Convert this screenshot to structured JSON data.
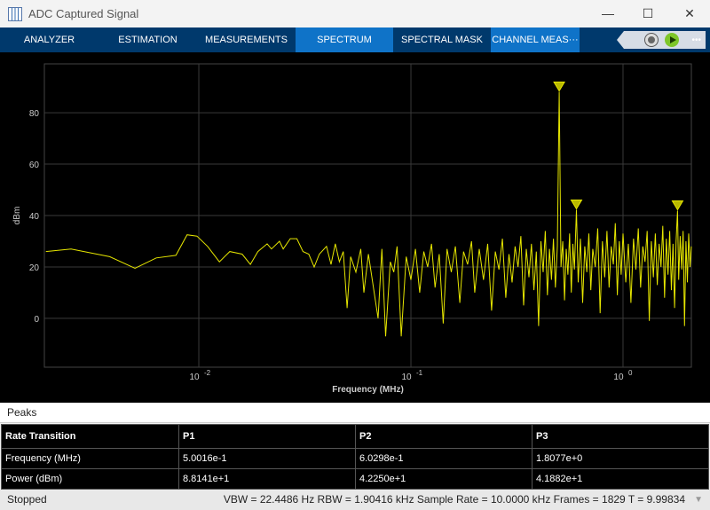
{
  "window": {
    "title": "ADC Captured Signal",
    "minimize": "—",
    "maximize": "☐",
    "close": "✕"
  },
  "tabs": [
    {
      "label": "ANALYZER"
    },
    {
      "label": "ESTIMATION"
    },
    {
      "label": "MEASUREMENTS"
    },
    {
      "label": "SPECTRUM",
      "active": true
    },
    {
      "label": "SPECTRAL MASK"
    },
    {
      "label": "CHANNEL MEAS···"
    }
  ],
  "toolbar": {
    "more": "•••",
    "icons": [
      "settings-gear-icon",
      "run-play-icon",
      "more-icon"
    ]
  },
  "colors": {
    "trace": "#e6e600",
    "marker": "#e6e600",
    "tab_bar": "#00396c",
    "active_tab": "#0f73c8"
  },
  "chart_data": {
    "type": "line",
    "xlabel": "Frequency (MHz)",
    "ylabel": "dBm",
    "xscale": "log",
    "xlim": [
      0.00187,
      2.1
    ],
    "ylim": [
      -19,
      99
    ],
    "xticks": [
      {
        "v": 0.01,
        "base": "10",
        "exp": "-2"
      },
      {
        "v": 0.1,
        "base": "10",
        "exp": "-1"
      },
      {
        "v": 1,
        "base": "10",
        "exp": "0"
      }
    ],
    "yticks": [
      0,
      20,
      40,
      60,
      80
    ],
    "grid": true,
    "trace": [
      [
        0.0019,
        26
      ],
      [
        0.0025,
        27
      ],
      [
        0.0038,
        24
      ],
      [
        0.005,
        19.5
      ],
      [
        0.0063,
        23.5
      ],
      [
        0.0078,
        24.5
      ],
      [
        0.0088,
        32.5
      ],
      [
        0.0098,
        32
      ],
      [
        0.011,
        28
      ],
      [
        0.0125,
        22
      ],
      [
        0.014,
        26
      ],
      [
        0.016,
        25
      ],
      [
        0.0175,
        21
      ],
      [
        0.019,
        26
      ],
      [
        0.021,
        29
      ],
      [
        0.022,
        27
      ],
      [
        0.024,
        30
      ],
      [
        0.025,
        27
      ],
      [
        0.027,
        31
      ],
      [
        0.029,
        31
      ],
      [
        0.031,
        26
      ],
      [
        0.033,
        25
      ],
      [
        0.035,
        20
      ],
      [
        0.037,
        25
      ],
      [
        0.04,
        28
      ],
      [
        0.042,
        21
      ],
      [
        0.044,
        29
      ],
      [
        0.046,
        22
      ],
      [
        0.048,
        26
      ],
      [
        0.05,
        4
      ],
      [
        0.052,
        24
      ],
      [
        0.055,
        18
      ],
      [
        0.058,
        27
      ],
      [
        0.06,
        10
      ],
      [
        0.063,
        25
      ],
      [
        0.066,
        14
      ],
      [
        0.07,
        0
      ],
      [
        0.073,
        27
      ],
      [
        0.076,
        -7
      ],
      [
        0.08,
        22
      ],
      [
        0.083,
        18
      ],
      [
        0.086,
        28
      ],
      [
        0.09,
        -7
      ],
      [
        0.095,
        24
      ],
      [
        0.1,
        15
      ],
      [
        0.105,
        27
      ],
      [
        0.11,
        10
      ],
      [
        0.115,
        26
      ],
      [
        0.12,
        20
      ],
      [
        0.125,
        29
      ],
      [
        0.13,
        12
      ],
      [
        0.136,
        25
      ],
      [
        0.142,
        -2
      ],
      [
        0.148,
        27
      ],
      [
        0.155,
        18
      ],
      [
        0.162,
        28
      ],
      [
        0.17,
        6
      ],
      [
        0.177,
        26
      ],
      [
        0.185,
        21
      ],
      [
        0.193,
        30
      ],
      [
        0.2,
        10
      ],
      [
        0.21,
        27
      ],
      [
        0.22,
        15
      ],
      [
        0.23,
        29
      ],
      [
        0.24,
        3
      ],
      [
        0.25,
        26
      ],
      [
        0.26,
        19
      ],
      [
        0.27,
        31
      ],
      [
        0.28,
        8
      ],
      [
        0.29,
        25
      ],
      [
        0.3,
        14
      ],
      [
        0.31,
        28
      ],
      [
        0.32,
        20
      ],
      [
        0.33,
        32
      ],
      [
        0.34,
        5
      ],
      [
        0.35,
        27
      ],
      [
        0.36,
        16
      ],
      [
        0.37,
        29
      ],
      [
        0.38,
        11
      ],
      [
        0.39,
        26
      ],
      [
        0.4,
        -3
      ],
      [
        0.41,
        30
      ],
      [
        0.42,
        18
      ],
      [
        0.43,
        34
      ],
      [
        0.44,
        9
      ],
      [
        0.45,
        27
      ],
      [
        0.46,
        15
      ],
      [
        0.47,
        31
      ],
      [
        0.48,
        12
      ],
      [
        0.49,
        28
      ],
      [
        0.50016,
        88.141
      ],
      [
        0.51,
        20
      ],
      [
        0.52,
        30
      ],
      [
        0.53,
        7
      ],
      [
        0.54,
        27
      ],
      [
        0.55,
        17
      ],
      [
        0.56,
        33
      ],
      [
        0.57,
        10
      ],
      [
        0.58,
        29
      ],
      [
        0.59,
        19
      ],
      [
        0.60298,
        42.25
      ],
      [
        0.615,
        14
      ],
      [
        0.63,
        31
      ],
      [
        0.645,
        6
      ],
      [
        0.66,
        28
      ],
      [
        0.675,
        18
      ],
      [
        0.69,
        33
      ],
      [
        0.705,
        11
      ],
      [
        0.72,
        27
      ],
      [
        0.74,
        20
      ],
      [
        0.76,
        35
      ],
      [
        0.78,
        2
      ],
      [
        0.8,
        30
      ],
      [
        0.82,
        16
      ],
      [
        0.84,
        34
      ],
      [
        0.86,
        12
      ],
      [
        0.88,
        28
      ],
      [
        0.9,
        21
      ],
      [
        0.92,
        37
      ],
      [
        0.94,
        9
      ],
      [
        0.96,
        30
      ],
      [
        0.98,
        17
      ],
      [
        1.0,
        33
      ],
      [
        1.03,
        14
      ],
      [
        1.06,
        29
      ],
      [
        1.09,
        6
      ],
      [
        1.12,
        31
      ],
      [
        1.15,
        19
      ],
      [
        1.18,
        35
      ],
      [
        1.21,
        12
      ],
      [
        1.24,
        28
      ],
      [
        1.27,
        22
      ],
      [
        1.3,
        34
      ],
      [
        1.33,
        -1
      ],
      [
        1.36,
        30
      ],
      [
        1.39,
        16
      ],
      [
        1.42,
        33
      ],
      [
        1.45,
        13
      ],
      [
        1.48,
        29
      ],
      [
        1.51,
        20
      ],
      [
        1.54,
        36
      ],
      [
        1.57,
        8
      ],
      [
        1.6,
        31
      ],
      [
        1.63,
        17
      ],
      [
        1.66,
        34
      ],
      [
        1.69,
        11
      ],
      [
        1.72,
        29
      ],
      [
        1.75,
        4
      ],
      [
        1.78,
        30
      ],
      [
        1.8077,
        41.882
      ],
      [
        1.83,
        15
      ],
      [
        1.86,
        32
      ],
      [
        1.89,
        19
      ],
      [
        1.92,
        34
      ],
      [
        1.95,
        -3
      ],
      [
        1.98,
        30
      ],
      [
        2.01,
        14
      ],
      [
        2.04,
        33
      ],
      [
        2.07,
        20
      ],
      [
        2.1,
        28
      ]
    ],
    "markers": [
      {
        "freq": 0.50016,
        "power": 88.141
      },
      {
        "freq": 0.60298,
        "power": 42.25
      },
      {
        "freq": 1.8077,
        "power": 41.882
      }
    ]
  },
  "peaks": {
    "title": "Peaks",
    "headers": [
      "Rate Transition",
      "P1",
      "P2",
      "P3"
    ],
    "rows": [
      [
        "Frequency (MHz)",
        "5.0016e-1",
        "6.0298e-1",
        "1.8077e+0"
      ],
      [
        "Power (dBm)",
        "8.8141e+1",
        "4.2250e+1",
        "4.1882e+1"
      ]
    ]
  },
  "status": {
    "state": "Stopped",
    "info": "VBW = 22.4486 Hz  RBW = 1.90416 kHz  Sample Rate = 10.0000 kHz  Frames = 1829  T = 9.99834"
  }
}
